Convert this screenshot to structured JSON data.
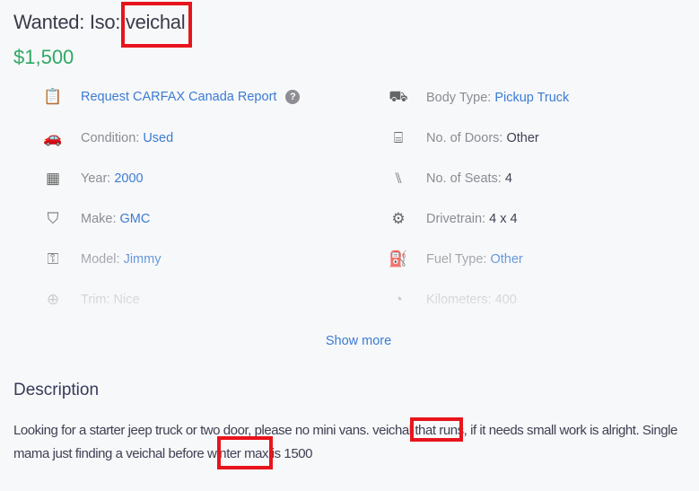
{
  "listing": {
    "title": "Wanted: Iso: veichal",
    "price": "$1,500"
  },
  "carfax": {
    "label": "Request CARFAX Canada Report",
    "help": "?"
  },
  "attributes": {
    "left": [
      {
        "label": "Condition:",
        "value": "Used",
        "icon": "car-condition-icon"
      },
      {
        "label": "Year:",
        "value": "2000",
        "icon": "calendar-icon"
      },
      {
        "label": "Make:",
        "value": "GMC",
        "icon": "shield-badge-icon"
      },
      {
        "label": "Model:",
        "value": "Jimmy",
        "icon": "car-key-icon"
      },
      {
        "label": "Trim:",
        "value": "Nice",
        "icon": "plus-circle-icon"
      }
    ],
    "right": [
      {
        "label": "Body Type:",
        "value": "Pickup Truck",
        "icon": "pickup-truck-icon"
      },
      {
        "label": "No. of Doors:",
        "value": "Other",
        "icon": "car-door-icon"
      },
      {
        "label": "No. of Seats:",
        "value": "4",
        "icon": "car-seat-icon"
      },
      {
        "label": "Drivetrain:",
        "value": "4 x 4",
        "icon": "wheel-icon"
      },
      {
        "label": "Fuel Type:",
        "value": "Other",
        "icon": "fuel-pump-icon"
      },
      {
        "label": "Kilometers:",
        "value": "400",
        "icon": "speedometer-icon"
      }
    ]
  },
  "show_more": "Show more",
  "description": {
    "heading": "Description",
    "text": "Looking for a starter jeep truck or two door, please no mini vans. veichal that runs, if it needs small work is alright. Single mama just finding a veichal before winter max is 1500"
  },
  "colors": {
    "price": "#2fa865",
    "link": "#3b7bd4",
    "highlight_box": "#e8141c"
  }
}
